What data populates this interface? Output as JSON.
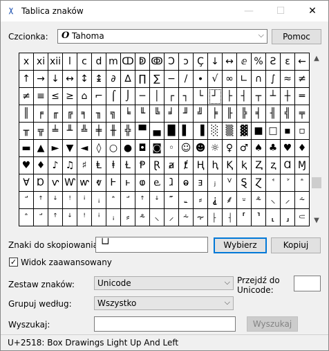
{
  "window": {
    "title": "Tablica znaków",
    "icon": "character-map-icon"
  },
  "titlebar_buttons": {
    "minimize": "—",
    "maximize": "☐",
    "close": "✕"
  },
  "font": {
    "label": "Czcionka:",
    "value": "Tahoma",
    "glyph": "O",
    "help": "Pomoc"
  },
  "grid": {
    "rows": [
      [
        "x",
        "xi",
        "xii",
        "l",
        "c",
        "d",
        "m",
        "ↀ",
        "ↁ",
        "ↂ",
        "Ↄ",
        "ↄ",
        "Ç",
        "↓",
        "↔",
        "ⅇ",
        "%",
        "Ƨ",
        "ɛ",
        "←"
      ],
      [
        "↑",
        "→",
        "↓",
        "↔",
        "↕",
        "↨",
        "∂",
        "∆",
        "∏",
        "∑",
        "−",
        "/",
        "∙",
        "√",
        "∞",
        "∟",
        "∩",
        "∫",
        "≈",
        "≠"
      ],
      [
        "≠",
        "≡",
        "≤",
        "≥",
        "⌂",
        "⌐",
        "⌠",
        "⌡",
        "─",
        "│",
        "┌",
        "┐",
        "└",
        "┘",
        "├",
        "┤",
        "┬",
        "┴",
        "┼",
        "═"
      ],
      [
        "║",
        "╒",
        "╓",
        "╔",
        "╕",
        "╖",
        "╗",
        "╘",
        "╙",
        "╚",
        "╛",
        "╜",
        "╝",
        "╞",
        "╟",
        "╠",
        "╡",
        "╢",
        "╣",
        "╤"
      ],
      [
        "╥",
        "╦",
        "╧",
        "╨",
        "╩",
        "╪",
        "╫",
        "╬",
        "▀",
        "▄",
        "█",
        "▌",
        "▐",
        "░",
        "▒",
        "▓",
        "■",
        "□",
        "▪",
        "▫"
      ],
      [
        "▬",
        "▲",
        "►",
        "▼",
        "◄",
        "◊",
        "○",
        "●",
        "◘",
        "◙",
        "◦",
        "☺",
        "☻",
        "☼",
        "♀",
        "♂",
        "♠",
        "♣",
        "♥",
        "♦"
      ],
      [
        "♥",
        "♦",
        "♪",
        "♫",
        "♯",
        "Ⱡ",
        "ⱡ",
        "Ɫ",
        "Ᵽ",
        "Ɽ",
        "ⱥ",
        "ⱦ",
        "Ⱨ",
        "ⱨ",
        "Ⱪ",
        "ⱪ",
        "Ⱬ",
        "ⱬ",
        "Ɑ",
        "Ɱ"
      ],
      [
        "Ɐ",
        "Ɒ",
        "ⱱ",
        "Ⱳ",
        "ⱳ",
        "ⱴ",
        "Ⱶ",
        "ⱶ",
        "ⱷ",
        "ⱸ",
        "ⱹ",
        "ⱺ",
        "ⱻ",
        "ⱼ",
        "ⱽ",
        "Ȿ",
        "Ɀ",
        "ꜗ",
        "ꜘ",
        "ꜙ"
      ],
      [
        "ꜚ",
        "ꜛ",
        "ꜜ",
        "ꜝ",
        "ꜞ",
        "ꜟ",
        "ꜙ",
        "ꜚ",
        "ꜛ",
        "ꜜ",
        "꜠",
        "꜡",
        "⸗",
        "⸘",
        "⸙",
        "⸚",
        "⸛",
        "⸜",
        "⸝",
        "⸞"
      ],
      [
        "ꜙ",
        "ꜚ",
        "ꜛ",
        "ꜜ",
        "ꜝ",
        "ꜞ",
        "ꜟ",
        "⸗",
        "⸛",
        "⸜",
        "⸝",
        "⸞",
        "⸟",
        "⸠",
        "⸡",
        "⸢",
        "⸣",
        "⸤",
        "⸥",
        "⸦"
      ]
    ],
    "selected_row": 2,
    "selected_col": 13
  },
  "copy": {
    "label": "Znaki do skopiowania:",
    "value": "└┘",
    "select": "Wybierz",
    "copy": "Kopiuj"
  },
  "advanced": {
    "label": "Widok zaawansowany",
    "checked": "✓"
  },
  "charset": {
    "label": "Zestaw znaków:",
    "value": "Unicode"
  },
  "goto_unicode": {
    "label_line1": "Przejdź do",
    "label_line2": "Unicode:",
    "value": ""
  },
  "groupby": {
    "label": "Grupuj według:",
    "value": "Wszystko"
  },
  "search": {
    "label": "Wyszukaj:",
    "value": "",
    "button": "Wyszukaj"
  },
  "status": {
    "text": "U+2518: Box Drawings Light Up And Left"
  }
}
